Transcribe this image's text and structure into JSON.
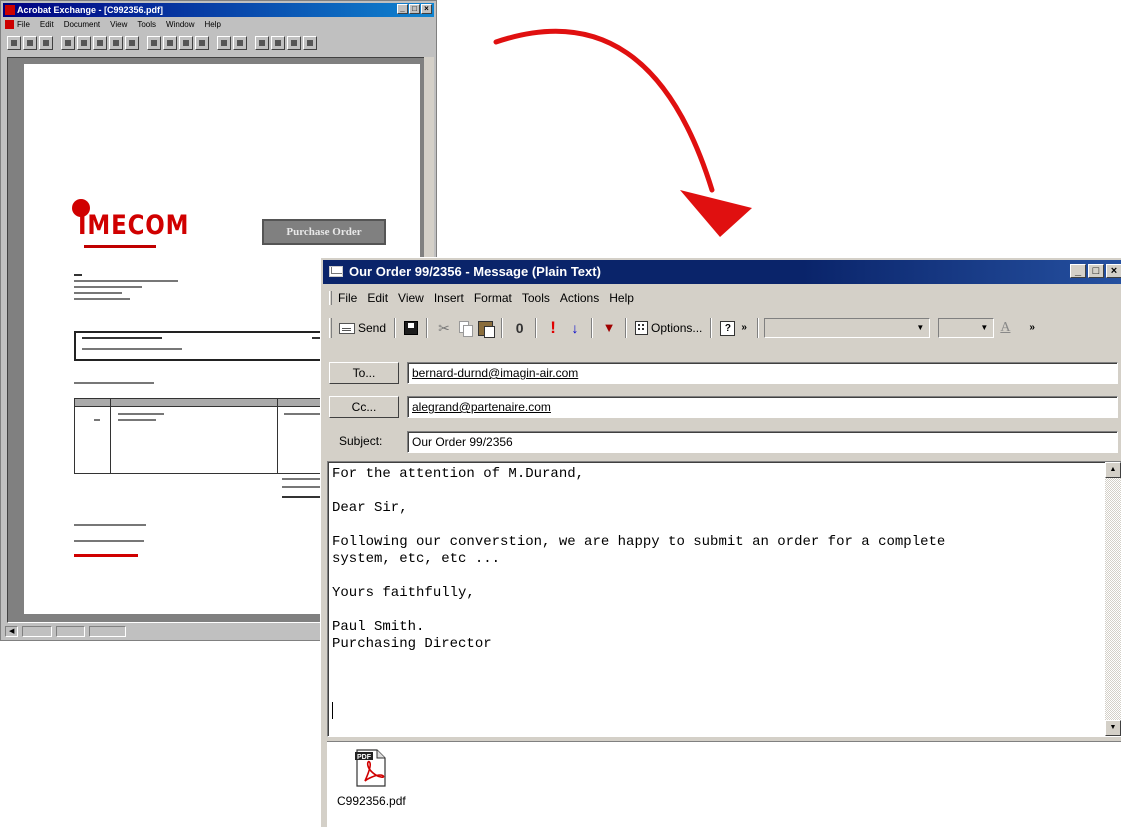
{
  "acrobat": {
    "title": "Acrobat Exchange - [C992356.pdf]",
    "menu": [
      "File",
      "Edit",
      "Document",
      "View",
      "Tools",
      "Window",
      "Help"
    ],
    "page_title_box": "Purchase Order",
    "logo_text": "IMECOM"
  },
  "message": {
    "title": "Our Order 99/2356 - Message (Plain Text)",
    "window_buttons": [
      "_",
      "□",
      "×"
    ],
    "menu": [
      "File",
      "Edit",
      "View",
      "Insert",
      "Format",
      "Tools",
      "Actions",
      "Help"
    ],
    "toolbar": {
      "send_label": "Send",
      "options_label": "Options...",
      "icons": [
        "send-icon",
        "save-icon",
        "cut-icon",
        "copy-icon",
        "paste-icon",
        "attach-icon",
        "high-importance-icon",
        "low-importance-icon",
        "flag-icon",
        "options-icon",
        "help-icon",
        "font-color-icon"
      ]
    },
    "to_button": "To...",
    "to_value": "bernard-durnd@imagin-air.com",
    "cc_button": "Cc...",
    "cc_value": "alegrand@partenaire.com",
    "subject_label": "Subject:",
    "subject_value": "Our Order 99/2356",
    "body_lines": [
      "For the attention of M.Durand,",
      "",
      "Dear Sir,",
      "",
      "Following our converstion, we are happy to submit an order for a complete",
      "system, etc, etc ...",
      "",
      "Yours faithfully,",
      "",
      "Paul Smith.",
      "Purchasing Director"
    ],
    "attachment": {
      "icon_label": "PDF",
      "filename": "C992356.pdf"
    }
  },
  "colors": {
    "titlebar": "#0a246a",
    "arrow": "#e01010",
    "logo_red": "#d00000"
  }
}
